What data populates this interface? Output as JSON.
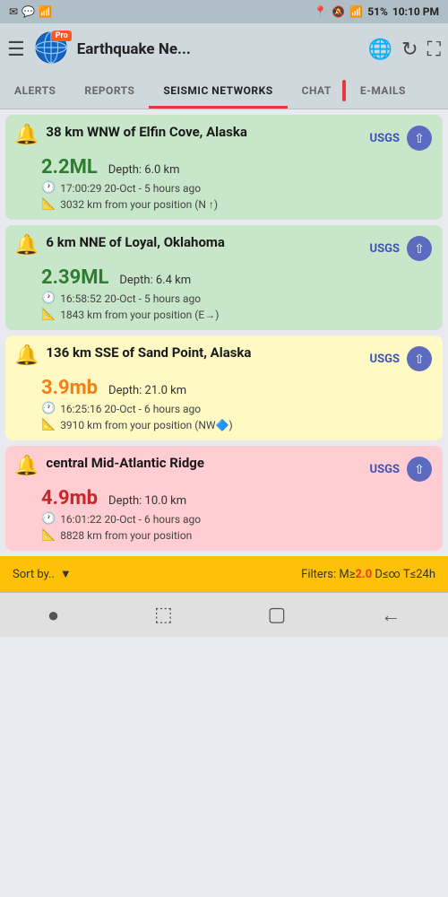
{
  "statusBar": {
    "icons_left": [
      "email-icon",
      "message-icon",
      "signal-icon"
    ],
    "location": "📍",
    "battery": "51%",
    "time": "10:10 PM"
  },
  "header": {
    "menu_label": "☰",
    "title": "Earthquake Ne...",
    "pro_label": "Pro",
    "globe_icon": "🌐",
    "refresh_icon": "↻",
    "expand_icon": "⛶"
  },
  "tabs": [
    {
      "label": "ALERTS",
      "active": false
    },
    {
      "label": "REPORTS",
      "active": false
    },
    {
      "label": "SEISMIC NETWORKS",
      "active": true
    },
    {
      "label": "CHAT",
      "active": false
    },
    {
      "label": "E-MAILS",
      "active": false
    }
  ],
  "earthquakes": [
    {
      "id": 1,
      "title": "38 km WNW of Elfin Cove, Alaska",
      "magnitude": "2.2",
      "magnitude_type": "ML",
      "magnitude_color": "green-text",
      "depth_label": "Depth:",
      "depth_value": "6.0 km",
      "time": "17:00:29 20-Oct - 5 hours ago",
      "distance": "3032 km from your position (N ↑)",
      "source": "USGS",
      "card_color": "green"
    },
    {
      "id": 2,
      "title": "6 km NNE of Loyal, Oklahoma",
      "magnitude": "2.39",
      "magnitude_type": "ML",
      "magnitude_color": "green-text",
      "depth_label": "Depth:",
      "depth_value": "6.4 km",
      "time": "16:58:52 20-Oct - 5 hours ago",
      "distance": "1843 km from your position (E→)",
      "source": "USGS",
      "card_color": "green"
    },
    {
      "id": 3,
      "title": "136 km SSE of Sand Point, Alaska",
      "magnitude": "3.9",
      "magnitude_type": "mb",
      "magnitude_color": "orange-text",
      "depth_label": "Depth:",
      "depth_value": "21.0 km",
      "time": "16:25:16 20-Oct - 6 hours ago",
      "distance": "3910 km from your position (NW🔷)",
      "source": "USGS",
      "card_color": "yellow"
    },
    {
      "id": 4,
      "title": "central Mid-Atlantic Ridge",
      "magnitude": "4.9",
      "magnitude_type": "mb",
      "magnitude_color": "red-text",
      "depth_label": "Depth:",
      "depth_value": "10.0 km",
      "time": "16:01:22 20-Oct - 6 hours ago",
      "distance": "8828 km from your position",
      "source": "USGS",
      "card_color": "red"
    }
  ],
  "bottomBar": {
    "sort_label": "Sort by..",
    "filters_prefix": "Filters: M≥",
    "filter_magnitude": "2.0",
    "filters_suffix": " D≤∞ T≤24h"
  },
  "navBar": {
    "icons": [
      "●",
      "⬚",
      "▢",
      "←"
    ]
  }
}
